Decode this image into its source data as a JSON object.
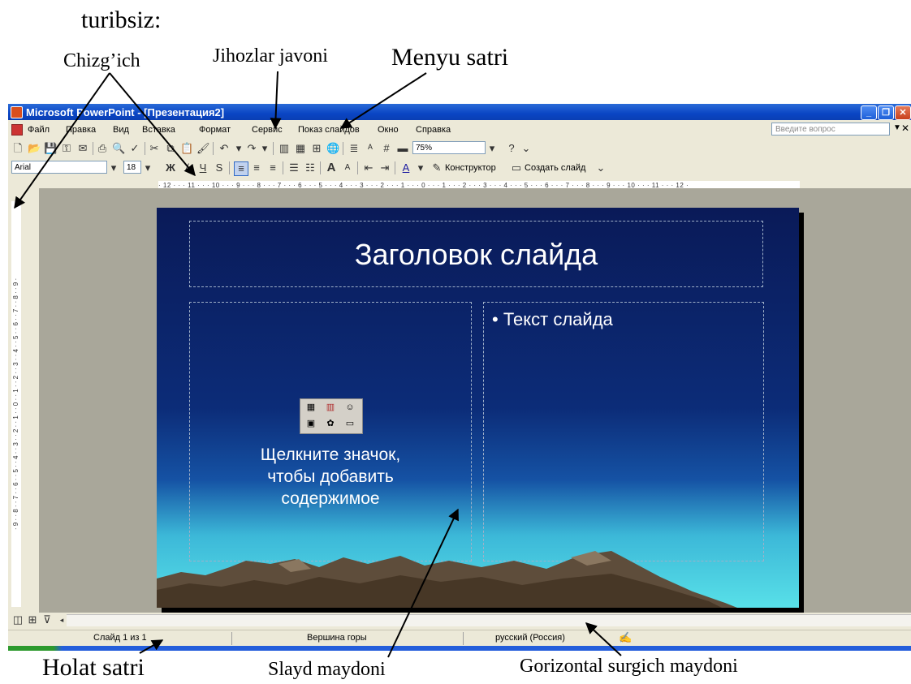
{
  "heading": "turibsiz:",
  "annotations": {
    "ruler": "Chizg’ich",
    "toolbars": "Jihozlar javoni",
    "menubar": "Menyu satri",
    "statusbar": "Holat satri",
    "slide_area": "Slayd maydoni",
    "hscroll": "Gorizontal surgich maydoni"
  },
  "window": {
    "title": "Microsoft PowerPoint - [Презентация2]",
    "menu": [
      "Файл",
      "Правка",
      "Вид",
      "Вставка",
      "Формат",
      "Сервис",
      "Показ слайдов",
      "Окно",
      "Справка"
    ],
    "help_placeholder": "Введите вопрос"
  },
  "toolbar1": {
    "zoom": "75%"
  },
  "toolbar2": {
    "font": "Arial",
    "size": "18",
    "bold": "Ж",
    "underline": "Ч",
    "shadow": "S",
    "designer": "Конструктор",
    "new_slide": "Создать слайд"
  },
  "ruler_horizontal": "· 12 · · · 11 · · · 10 · · · 9 · · · 8 · · · 7 · · · 6 · · · 5 · · · 4 · · · 3 · · · 2 · · · 1 · · · 0 · · · 1 · · · 2 · · · 3 · · · 4 · · · 5 · · · 6 · · · 7 · · · 8 · · · 9 · · · 10 · · · 11 · · · 12 ·",
  "ruler_vertical": "· 9 · · 8 · · 7 · · 6 · · 5 · · 4 · · 3 · · 2 · · 1 · · 0 · · 1 · · 2 · · 3 · · 4 · · 5 · · 6 · · 7 · · 8 · · 9 ·",
  "slide": {
    "title": "Заголовок слайда",
    "bullet": "Текст слайда",
    "placeholder_lines": [
      "Щелкните значок,",
      "чтобы добавить",
      "содержимое"
    ]
  },
  "status": {
    "slide": "Слайд 1 из 1",
    "design": "Вершина горы",
    "language": "русский (Россия)"
  }
}
